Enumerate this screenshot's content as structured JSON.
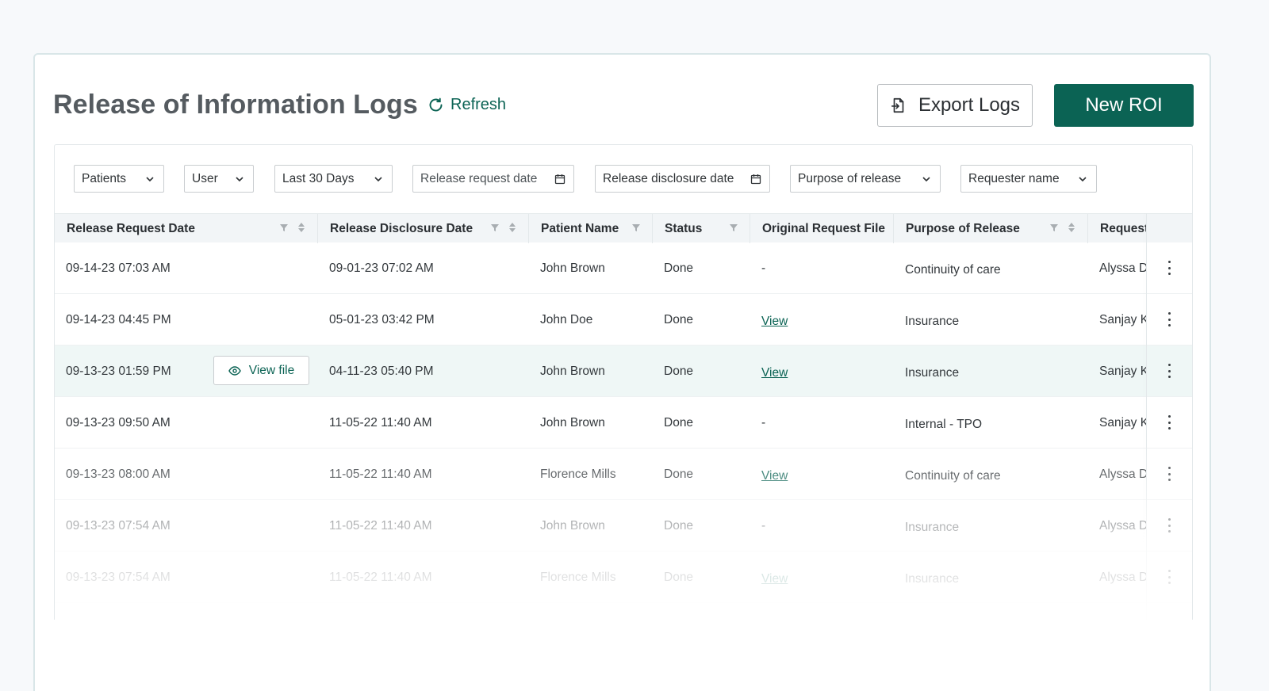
{
  "header": {
    "title": "Release of Information Logs",
    "refresh_label": "Refresh",
    "export_label": "Export Logs",
    "new_label": "New ROI"
  },
  "filters": {
    "patients": "Patients",
    "user": "User",
    "range": "Last 30 Days",
    "request_date": "Release request date",
    "disclosure_date": "Release disclosure date",
    "purpose": "Purpose of release",
    "requester": "Requester name"
  },
  "table": {
    "headers": {
      "request_date": "Release Request Date",
      "disclosure_date": "Release Disclosure Date",
      "patient": "Patient Name",
      "status": "Status",
      "file": "Original Request File",
      "purpose": "Purpose of Release",
      "requester": "Requester Name"
    },
    "view_file_label": "View file",
    "rows": [
      {
        "request_date": "09-14-23 07:03 AM",
        "disclosure_date": "09-01-23 07:02 AM",
        "patient": "John Brown",
        "status": "Done",
        "file": "-",
        "purpose": "Continuity of care",
        "requester": "Alyssa D"
      },
      {
        "request_date": "09-14-23 04:45 PM",
        "disclosure_date": "05-01-23 03:42 PM",
        "patient": "John Doe",
        "status": "Done",
        "file": "View",
        "purpose": "Insurance",
        "requester": "Sanjay K"
      },
      {
        "request_date": "09-13-23 01:59 PM",
        "disclosure_date": "04-11-23 05:40 PM",
        "patient": "John Brown",
        "status": "Done",
        "file": "View",
        "purpose": "Insurance",
        "requester": "Sanjay K"
      },
      {
        "request_date": "09-13-23 09:50 AM",
        "disclosure_date": "11-05-22 11:40 AM",
        "patient": "John Brown",
        "status": "Done",
        "file": "-",
        "purpose": "Internal - TPO",
        "requester": "Sanjay K"
      },
      {
        "request_date": "09-13-23 08:00 AM",
        "disclosure_date": "11-05-22 11:40 AM",
        "patient": "Florence Mills",
        "status": "Done",
        "file": "View",
        "purpose": "Continuity of care",
        "requester": "Alyssa D"
      },
      {
        "request_date": "09-13-23 07:54 AM",
        "disclosure_date": "11-05-22 11:40 AM",
        "patient": "John Brown",
        "status": "Done",
        "file": "-",
        "purpose": "Insurance",
        "requester": "Alyssa D"
      },
      {
        "request_date": "09-13-23 07:54 AM",
        "disclosure_date": "11-05-22 11:40 AM",
        "patient": "Florence Mills",
        "status": "Done",
        "file": "View",
        "purpose": "Insurance",
        "requester": "Alyssa D"
      }
    ]
  },
  "colors": {
    "accent": "#0b6354",
    "highlight_row": "#eff7f6",
    "header_bg": "#f2f5f7"
  }
}
